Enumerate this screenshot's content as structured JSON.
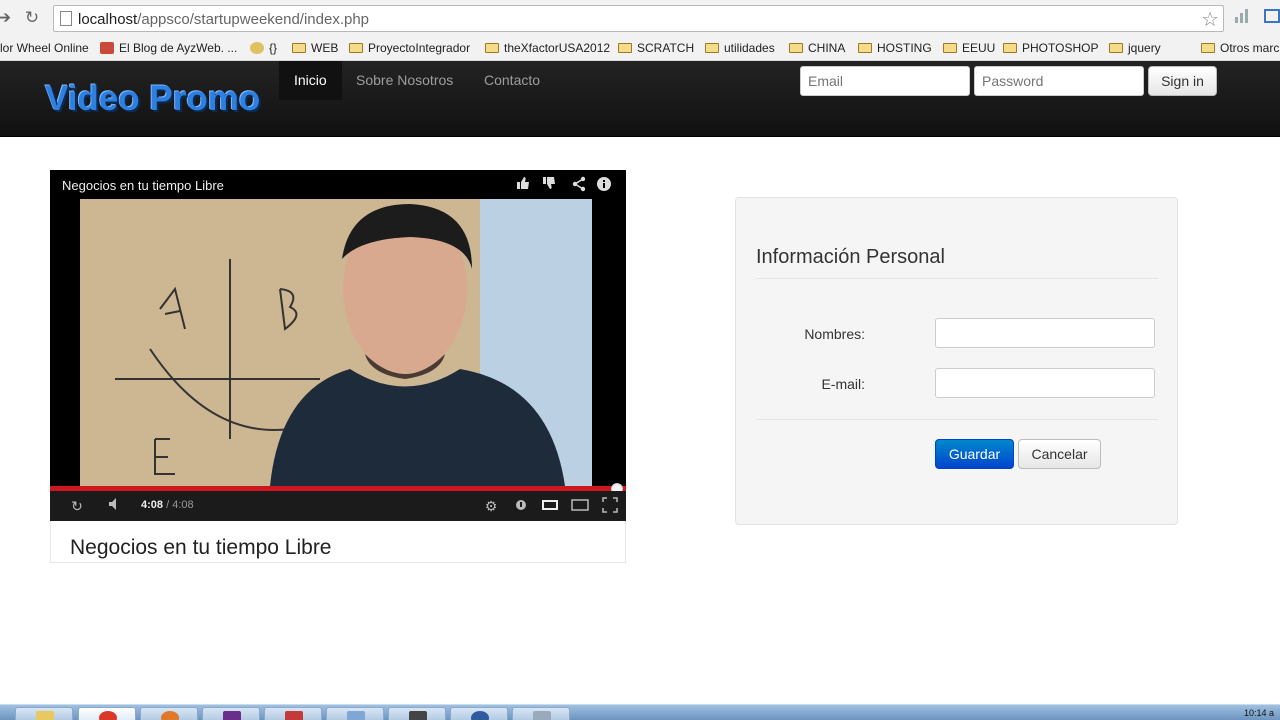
{
  "browser": {
    "url_host": "localhost",
    "url_path": "/appsco/startupweekend/index.php",
    "bookmarks": [
      "lor Wheel Online",
      "El Blog de AyzWeb. ...",
      "{}",
      "WEB",
      "ProyectoIntegrador",
      "theXfactorUSA2012",
      "SCRATCH",
      "utilidades",
      "CHINA",
      "HOSTING",
      "EEUU",
      "PHOTOSHOP",
      "jquery",
      "Otros marc"
    ]
  },
  "navbar": {
    "brand": "Video Promo",
    "items": [
      "Inicio",
      "Sobre Nosotros",
      "Contacto"
    ],
    "email_placeholder": "Email",
    "password_placeholder": "Password",
    "signin_label": "Sign in"
  },
  "video": {
    "title": "Negocios en tu tiempo Libre",
    "current_time": "4:08",
    "duration": "4:08",
    "progress": 1.0,
    "caption": "Negocios en tu tiempo Libre"
  },
  "form": {
    "legend": "Información Personal",
    "nombres_label": "Nombres:",
    "email_label": "E-mail:",
    "nombres_value": "",
    "email_value": "",
    "save_label": "Guardar",
    "cancel_label": "Cancelar"
  },
  "taskbar": {
    "clock": "10:14 a"
  },
  "colors": {
    "brand": "#2d7fe0",
    "navbar_bg": "#1b1b1b",
    "primary_button": "#0055cc",
    "progress": "#cc181e"
  }
}
